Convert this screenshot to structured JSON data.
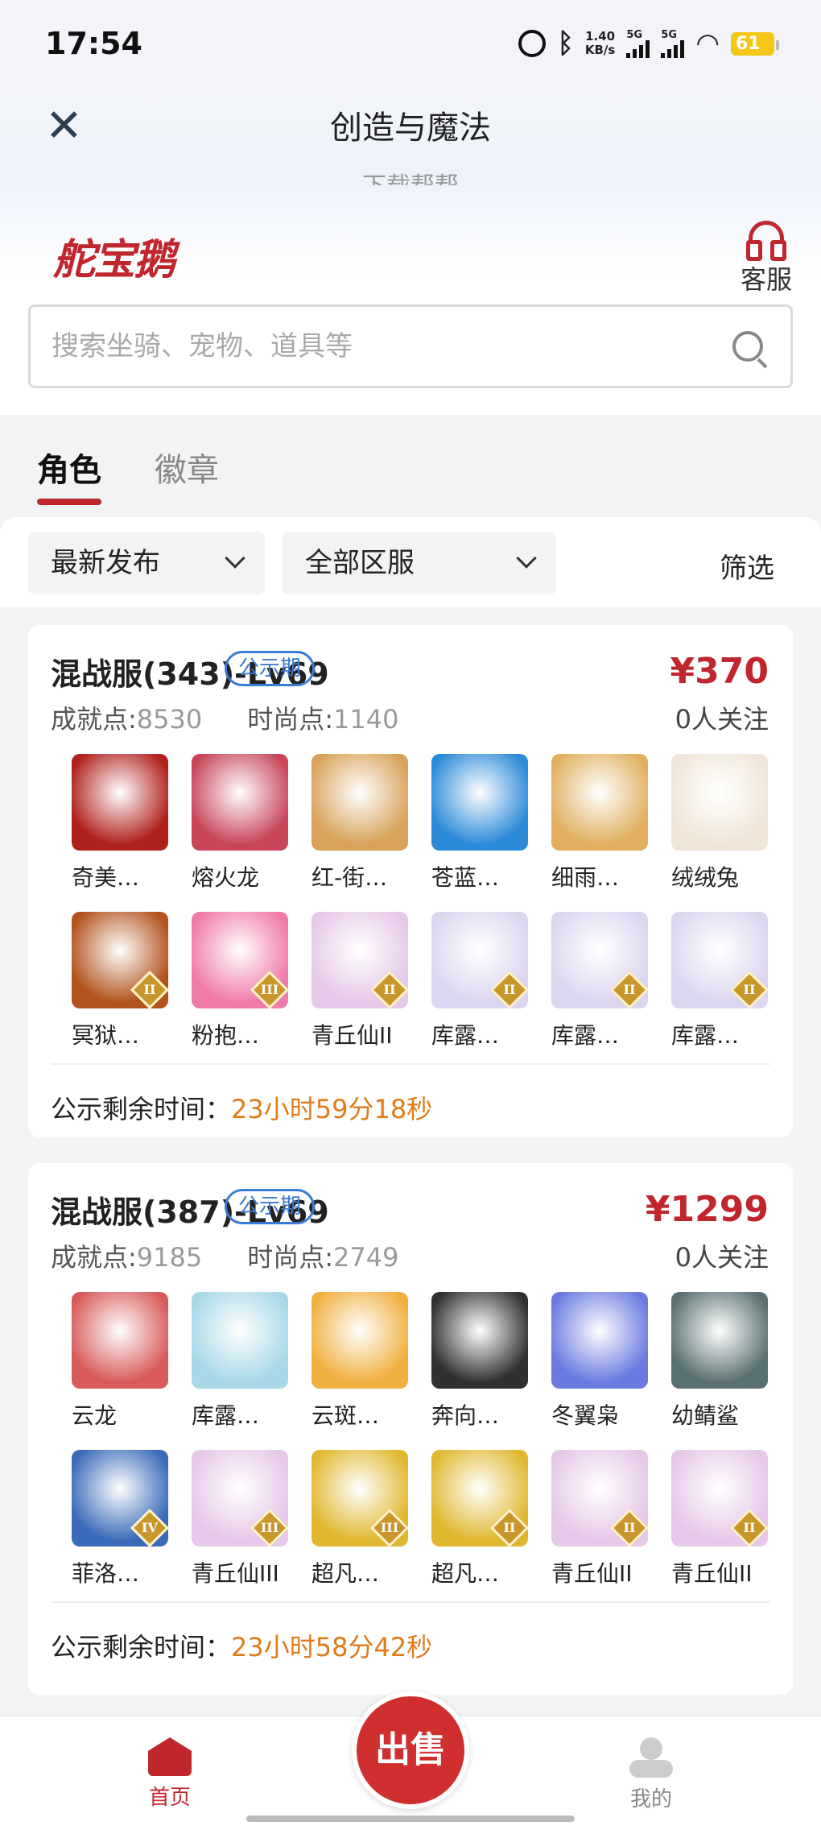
{
  "status_bar": {
    "time": "17:54",
    "net_speed_value": "1.40",
    "net_speed_unit": "KB/s",
    "signal1_label": "5G",
    "signal2_label": "5G",
    "battery": "61"
  },
  "nav": {
    "title": "创造与魔法",
    "ghost_text": "下载帮帮"
  },
  "brand": {
    "logo_text": "舵宝鹅",
    "service_label": "客服",
    "search_placeholder": "搜索坐骑、宠物、道具等"
  },
  "tabs": [
    {
      "label": "角色",
      "active": true
    },
    {
      "label": "徽章",
      "active": false
    }
  ],
  "filters": {
    "sort_label": "最新发布",
    "server_label": "全部区服",
    "screen_label": "筛选"
  },
  "listings": [
    {
      "title": "混战服(343)-Lv69",
      "badge": "公示期",
      "price": "¥370",
      "watchers": "0人关注",
      "achievement_label": "成就点:",
      "achievement_value": "8530",
      "fashion_label": "时尚点:",
      "fashion_value": "1140",
      "items": [
        {
          "name": "奇美…",
          "color": "#b0201c",
          "level": ""
        },
        {
          "name": "熔火龙",
          "color": "#c8455a",
          "level": ""
        },
        {
          "name": "红-街…",
          "color": "#d8a25a",
          "level": ""
        },
        {
          "name": "苍蓝…",
          "color": "#2a8ad8",
          "level": ""
        },
        {
          "name": "细雨…",
          "color": "#e0b060",
          "level": ""
        },
        {
          "name": "绒绒兔",
          "color": "#f0e6d8",
          "level": ""
        },
        {
          "name": "冥狱…",
          "color": "#b2521c",
          "level": "II"
        },
        {
          "name": "粉抱…",
          "color": "#f07aa8",
          "level": "III"
        },
        {
          "name": "青丘仙II",
          "color": "#e6c8e8",
          "level": "II"
        },
        {
          "name": "库露…",
          "color": "#dcd6f0",
          "level": "II"
        },
        {
          "name": "库露…",
          "color": "#dcd6f0",
          "level": "II"
        },
        {
          "name": "库露…",
          "color": "#dcd6f0",
          "level": "II"
        }
      ],
      "timer_label": "公示剩余时间：",
      "timer_value": "23小时59分18秒"
    },
    {
      "title": "混战服(387)-Lv69",
      "badge": "公示期",
      "price": "¥1299",
      "watchers": "0人关注",
      "achievement_label": "成就点:",
      "achievement_value": "9185",
      "fashion_label": "时尚点:",
      "fashion_value": "2749",
      "items": [
        {
          "name": "云龙",
          "color": "#d85a5a",
          "level": ""
        },
        {
          "name": "库露…",
          "color": "#a8d8e8",
          "level": ""
        },
        {
          "name": "云斑…",
          "color": "#f0b040",
          "level": ""
        },
        {
          "name": "奔向…",
          "color": "#303030",
          "level": ""
        },
        {
          "name": "冬翼枭",
          "color": "#6a7ae0",
          "level": ""
        },
        {
          "name": "幼鲭鲨",
          "color": "#5a7070",
          "level": ""
        },
        {
          "name": "菲洛…",
          "color": "#3a6ab8",
          "level": "IV"
        },
        {
          "name": "青丘仙III",
          "color": "#e6c8e8",
          "level": "III"
        },
        {
          "name": "超凡…",
          "color": "#e0b830",
          "level": "III"
        },
        {
          "name": "超凡…",
          "color": "#e0b830",
          "level": "II"
        },
        {
          "name": "青丘仙II",
          "color": "#e6c8e8",
          "level": "II"
        },
        {
          "name": "青丘仙II",
          "color": "#e6c8e8",
          "level": "II"
        }
      ],
      "timer_label": "公示剩余时间：",
      "timer_value": "23小时58分42秒"
    }
  ],
  "bottom_nav": {
    "home_label": "首页",
    "sell_label": "出售",
    "mine_label": "我的"
  }
}
